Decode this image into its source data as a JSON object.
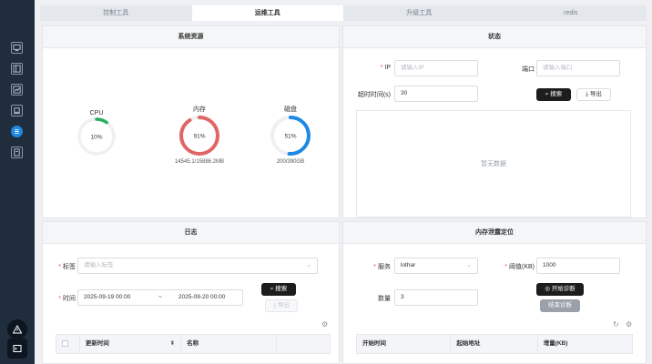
{
  "tabs": [
    {
      "label": "控制工具",
      "active": false
    },
    {
      "label": "运维工具",
      "active": true
    },
    {
      "label": "升级工具",
      "active": false
    },
    {
      "label": "redis",
      "active": false
    }
  ],
  "sidebar": {
    "icons": [
      "monitor-icon",
      "layout-icon",
      "chart-icon",
      "laptop-icon",
      "list-icon",
      "document-icon"
    ],
    "active_index": 4,
    "bottom_icons": [
      "warning-icon",
      "terminal-icon"
    ]
  },
  "system_resources": {
    "title": "系统资源",
    "gauges": [
      {
        "label": "CPU",
        "value_text": "10%",
        "percent": 10,
        "color": "#27ae60",
        "sub": ""
      },
      {
        "label": "内存",
        "value_text": "91%",
        "percent": 91,
        "color": "#e06666",
        "sub": "14545.1/15886.2MB"
      },
      {
        "label": "磁盘",
        "value_text": "51%",
        "percent": 51,
        "color": "#1e88e5",
        "sub": "200/390GB"
      }
    ]
  },
  "status_panel": {
    "title": "状态",
    "ip_label": "IP",
    "ip_placeholder": "请输入IP",
    "port_label": "端口",
    "port_placeholder": "请输入端口",
    "timeout_label": "超时时间(s)",
    "timeout_value": "30",
    "search_label": "搜索",
    "export_label": "导出",
    "empty_text": "暂无数据"
  },
  "log_panel": {
    "title": "日志",
    "tag_label": "标签",
    "tag_placeholder": "请输入标签",
    "time_label": "时间",
    "start_time": "2025-09-19 00:00",
    "range_sep": "~",
    "end_time": "2025-09-20 00:00",
    "search_label": "搜索",
    "export_label": "导出",
    "columns": [
      "",
      "更新时间",
      "名称",
      ""
    ]
  },
  "memory_panel": {
    "title": "内存泄露定位",
    "service_label": "服务",
    "service_value": "lothar",
    "threshold_label": "阈值(KB)",
    "threshold_value": "1000",
    "count_label": "数量",
    "count_value": "3",
    "start_label": "开始诊断",
    "stop_label": "结束诊断",
    "columns": [
      "开始时间",
      "起始地址",
      "增量(KB)"
    ]
  }
}
